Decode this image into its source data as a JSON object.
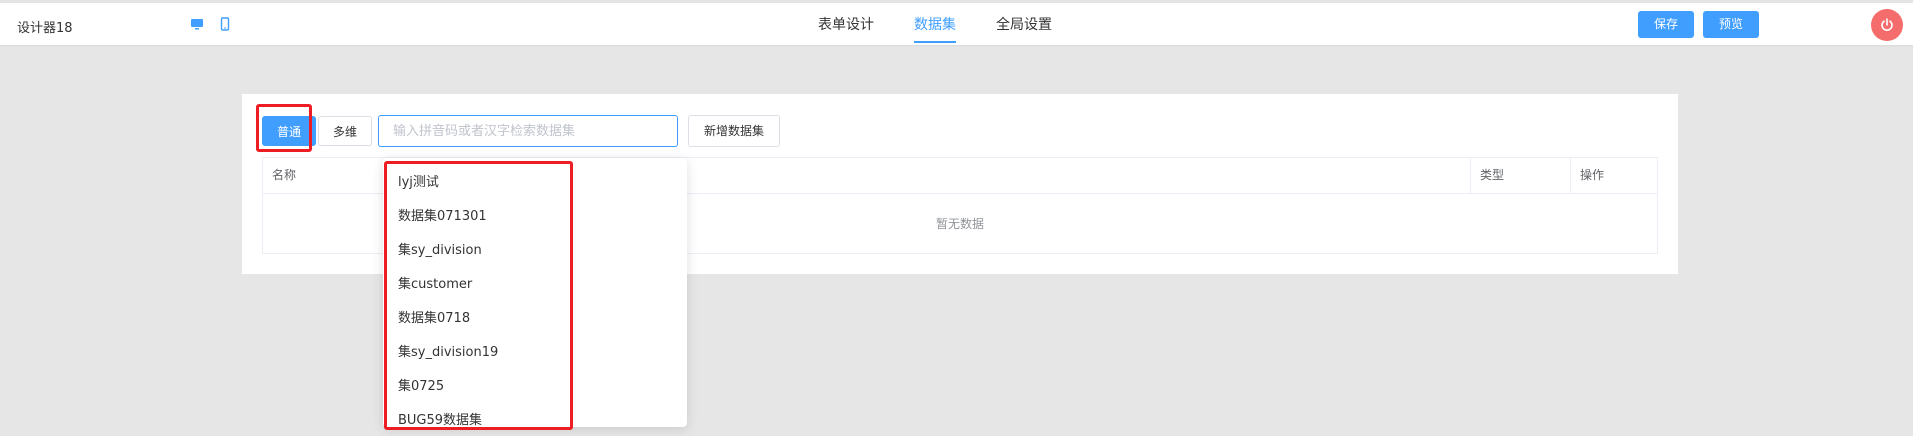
{
  "header": {
    "app_title": "设计器18",
    "devices": [
      {
        "icon": "desktop-icon"
      },
      {
        "icon": "mobile-icon"
      }
    ],
    "tabs": [
      {
        "label": "表单设计",
        "active": false
      },
      {
        "label": "数据集",
        "active": true
      },
      {
        "label": "全局设置",
        "active": false
      }
    ],
    "save_label": "保存",
    "preview_label": "预览",
    "power_icon": "power-icon",
    "accent_color": "#409eff",
    "danger_color": "#f56c6c"
  },
  "toolbar": {
    "modes": [
      {
        "label": "普通",
        "active": true
      },
      {
        "label": "多维",
        "active": false
      }
    ],
    "search_placeholder": "输入拼音码或者汉字检索数据集",
    "add_label": "新增数据集"
  },
  "table": {
    "columns": [
      "名称",
      "类型",
      "操作"
    ],
    "empty_text": "暂无数据"
  },
  "dropdown": {
    "items": [
      "lyj测试",
      "数据集071301",
      "集sy_division",
      "集customer",
      "数据集0718",
      "集sy_division19",
      "集0725",
      "BUG59数据集"
    ]
  },
  "highlight_color": "#ee1d23"
}
